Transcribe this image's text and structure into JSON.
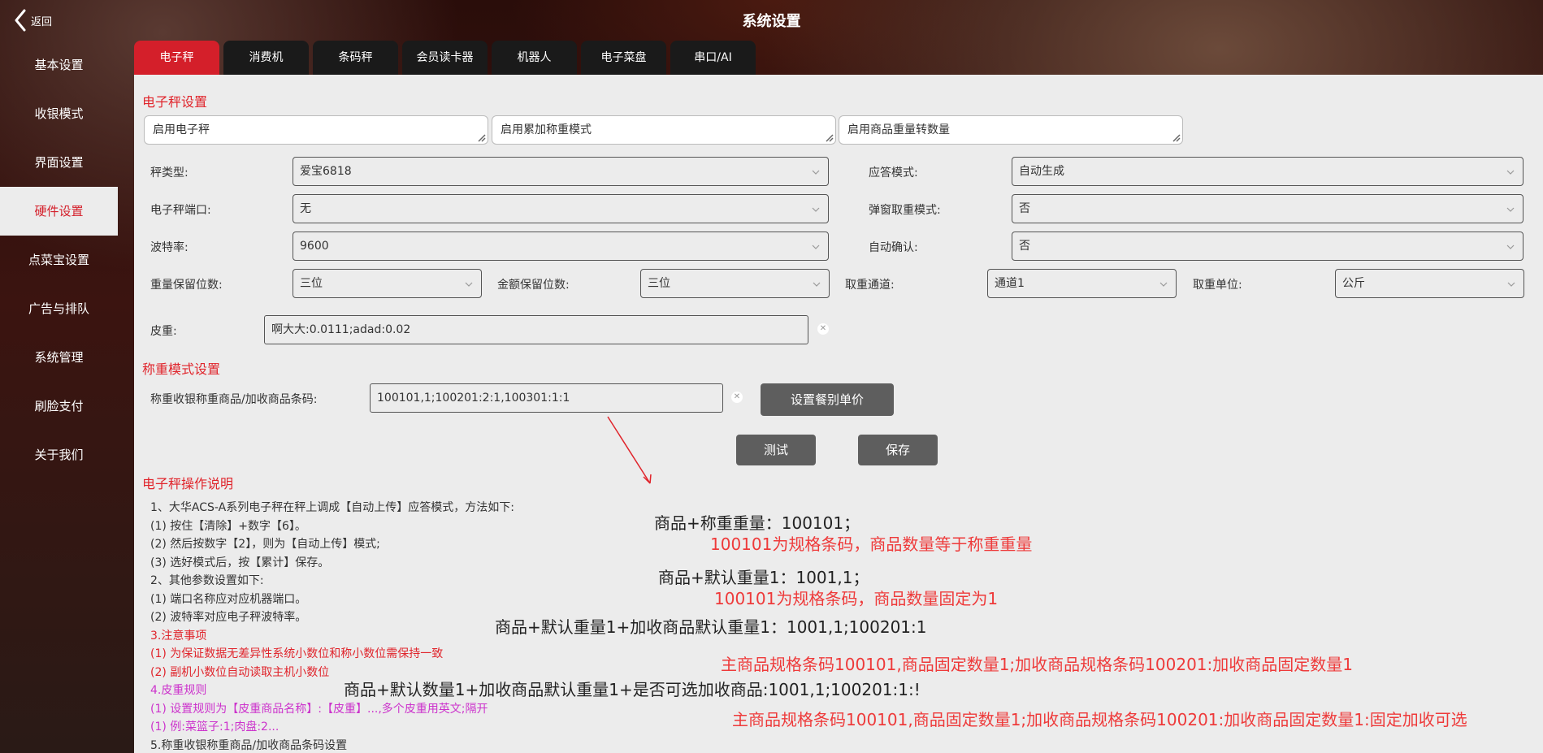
{
  "header": {
    "back_label": "返回",
    "title": "系统设置"
  },
  "sidebar": {
    "items": [
      {
        "label": "基本设置"
      },
      {
        "label": "收银模式"
      },
      {
        "label": "界面设置"
      },
      {
        "label": "硬件设置"
      },
      {
        "label": "点菜宝设置"
      },
      {
        "label": "广告与排队"
      },
      {
        "label": "系统管理"
      },
      {
        "label": "刷脸支付"
      },
      {
        "label": "关于我们"
      }
    ],
    "active_index": 3
  },
  "tabs": {
    "items": [
      {
        "label": "电子秤"
      },
      {
        "label": "消费机"
      },
      {
        "label": "条码秤"
      },
      {
        "label": "会员读卡器"
      },
      {
        "label": "机器人"
      },
      {
        "label": "电子菜盘"
      },
      {
        "label": "串口/AI"
      }
    ],
    "active_index": 0
  },
  "scale": {
    "section_title": "电子秤设置",
    "toggles": [
      "启用电子秤",
      "启用累加称重模式",
      "启用商品重量转数量"
    ],
    "scale_type": {
      "label": "秤类型:",
      "value": "爱宝6818"
    },
    "response_mode": {
      "label": "应答模式:",
      "value": "自动生成"
    },
    "port": {
      "label": "电子秤端口:",
      "value": "无"
    },
    "popup_weight": {
      "label": "弹窗取重模式:",
      "value": "否"
    },
    "baud": {
      "label": "波特率:",
      "value": "9600"
    },
    "auto_confirm": {
      "label": "自动确认:",
      "value": "否"
    },
    "weight_decimals": {
      "label": "重量保留位数:",
      "value": "三位"
    },
    "amount_decimals": {
      "label": "金额保留位数:",
      "value": "三位"
    },
    "channel": {
      "label": "取重通道:",
      "value": "通道1"
    },
    "unit": {
      "label": "取重单位:",
      "value": "公斤"
    },
    "tare": {
      "label": "皮重:",
      "value": "啊大大:0.0111;adad:0.02"
    }
  },
  "weigh_mode": {
    "section_title": "称重模式设置",
    "barcode_label": "称重收银称重商品/加收商品条码:",
    "barcode_value": "100101,1;100201:2:1,100301:1:1",
    "meal_price_button": "设置餐别单价",
    "test_button": "测试",
    "save_button": "保存"
  },
  "instructions": {
    "title": "电子秤操作说明",
    "lines": [
      {
        "text": "1、大华ACS-A系列电子秤在秤上调成【自动上传】应答模式，方法如下:",
        "color": "dark"
      },
      {
        "text": "(1) 按住【清除】+数字【6】。",
        "color": "dark"
      },
      {
        "text": "(2) 然后按数字【2】，则为【自动上传】模式;",
        "color": "dark"
      },
      {
        "text": "(3) 选好模式后，按【累计】保存。",
        "color": "dark"
      },
      {
        "text": "2、其他参数设置如下:",
        "color": "dark"
      },
      {
        "text": "(1) 端口名称应对应机器端口。",
        "color": "dark"
      },
      {
        "text": "(2) 波特率对应电子秤波特率。",
        "color": "dark"
      },
      {
        "text": "3.注意事项",
        "color": "red"
      },
      {
        "text": "(1) 为保证数据无差异性系统小数位和称小数位需保持一致",
        "color": "red"
      },
      {
        "text": "(2) 副机小数位自动读取主机小数位",
        "color": "red"
      },
      {
        "text": "4.皮重规则",
        "color": "mag"
      },
      {
        "text": "(1) 设置规则为【皮重商品名称】:【皮重】...,多个皮重用英文;隔开",
        "color": "mag"
      },
      {
        "text": "(1) 例:菜篮子:1;肉盘:2...",
        "color": "mag"
      },
      {
        "text": "5.称重收银称重商品/加收商品条码设置",
        "color": "dark"
      }
    ]
  },
  "annotations": [
    {
      "text": "商品+称重重量：100101；",
      "color": "black"
    },
    {
      "text": "100101为规格条码，商品数量等于称重重量",
      "color": "red"
    },
    {
      "text": "商品+默认重量1：1001,1；",
      "color": "black"
    },
    {
      "text": "100101为规格条码，商品数量固定为1",
      "color": "red"
    },
    {
      "text": "商品+默认重量1+加收商品默认重量1：1001,1;100201:1",
      "color": "black"
    },
    {
      "text": "主商品规格条码100101,商品固定数量1;加收商品规格条码100201:加收商品固定数量1",
      "color": "red"
    },
    {
      "text": "商品+默认数量1+加收商品默认重量1+是否可选加收商品:1001,1;100201:1:!",
      "color": "black"
    },
    {
      "text": "主商品规格条码100101,商品固定数量1;加收商品规格条码100201:加收商品固定数量1:固定加收可选",
      "color": "red"
    }
  ],
  "icons": {
    "back": "chevron-left-icon",
    "clear": "clear-icon",
    "caret": "chevron-down-icon",
    "resize": "resize-grip-icon"
  },
  "colors": {
    "accent": "#d41f2a",
    "tab_bg": "#1a1a1a",
    "panel_bg": "#ececec",
    "button_bg": "#5e5e5e"
  }
}
